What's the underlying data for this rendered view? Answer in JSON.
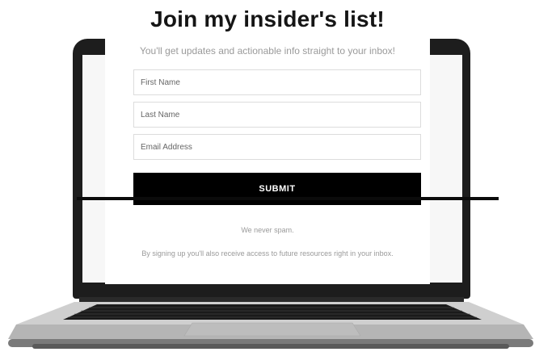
{
  "heading": "Join my insider's list!",
  "subheading": "You'll get updates and actionable info straight to your inbox!",
  "form": {
    "first_name_placeholder": "First Name",
    "last_name_placeholder": "Last Name",
    "email_placeholder": "Email Address",
    "first_name_value": "",
    "last_name_value": "",
    "email_value": "",
    "submit_label": "SUBMIT"
  },
  "footer": {
    "no_spam": "We never spam.",
    "note": "By signing up you'll also receive access to future resources right in your inbox."
  },
  "colors": {
    "button_bg": "#000000",
    "button_text": "#ffffff",
    "laptop_bezel": "#1d1d1d",
    "laptop_body": "#c9c9c9"
  },
  "icons": {
    "device": "laptop-icon",
    "keyboard": "keyboard-icon"
  }
}
